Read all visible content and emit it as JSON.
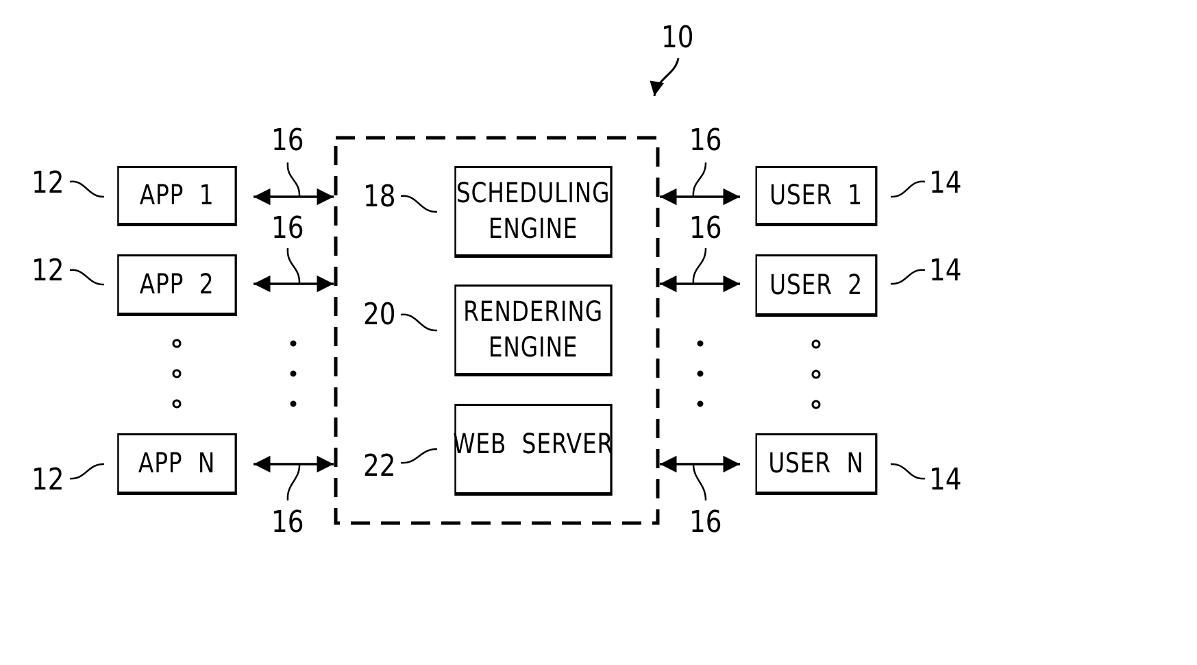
{
  "figure": {
    "system_ref": "10",
    "app_ref": "12",
    "user_ref": "14",
    "link_ref": "16",
    "apps": [
      {
        "label": "APP  1"
      },
      {
        "label": "APP  2"
      },
      {
        "label": "APP  N"
      }
    ],
    "users": [
      {
        "label": "USER  1"
      },
      {
        "label": "USER  2"
      },
      {
        "label": "USER  N"
      }
    ],
    "engines": [
      {
        "ref": "18",
        "lines": [
          "SCHEDULING",
          "ENGINE"
        ]
      },
      {
        "ref": "20",
        "lines": [
          "RENDERING",
          "ENGINE"
        ]
      },
      {
        "ref": "22",
        "lines": [
          "WEB  SERVER"
        ]
      }
    ],
    "ellipsis": "⋮"
  }
}
